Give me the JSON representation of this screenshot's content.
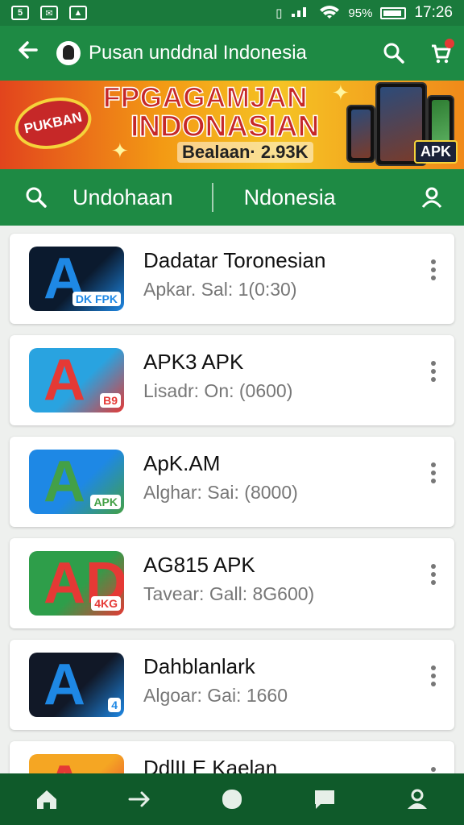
{
  "status_bar": {
    "battery": "95%",
    "time": "17:26"
  },
  "app_bar": {
    "title": "Pusan unddnal Indonesia"
  },
  "banner": {
    "badge": "PUKBAN",
    "headline_1": "FPGAGAMJAN",
    "headline_2": "INDONASIAN",
    "subtitle": "Bealaan· 2.93K",
    "apk_label": "APK"
  },
  "search_bar": {
    "tab_left": "Undohaan",
    "tab_right": "Ndonesia"
  },
  "apps": [
    {
      "name": "Dadatar Toronesian",
      "meta": "Apkar. Sal: 1(0:30)",
      "icon_label": "DK FPK",
      "colors": [
        "#0b1a2e",
        "#1e88e5"
      ]
    },
    {
      "name": "APK3 APK",
      "meta": "Lisadr: On: (0600)",
      "icon_label": "B9",
      "colors": [
        "#29a3e0",
        "#e53935"
      ]
    },
    {
      "name": "ApK.AM",
      "meta": "Alghar: Sai: (8000)",
      "icon_label": "APK",
      "colors": [
        "#1e88e5",
        "#43a047"
      ]
    },
    {
      "name": "AG815 APK",
      "meta": "Tavear: Gall: 8G600)",
      "icon_label": "4KG",
      "colors": [
        "#2e9e4a",
        "#e53935"
      ]
    },
    {
      "name": "Dahblanlark",
      "meta": "Algoar: Gai: 1660",
      "icon_label": "4",
      "colors": [
        "#111827",
        "#1e88e5"
      ]
    },
    {
      "name": "DdlILE Kaelan",
      "meta": "",
      "icon_label": "",
      "colors": [
        "#f5a623",
        "#e53935"
      ]
    }
  ],
  "bottom_nav": [
    "home-icon",
    "forward-arrow-icon",
    "circle-icon",
    "chat-icon",
    "profile-icon"
  ]
}
